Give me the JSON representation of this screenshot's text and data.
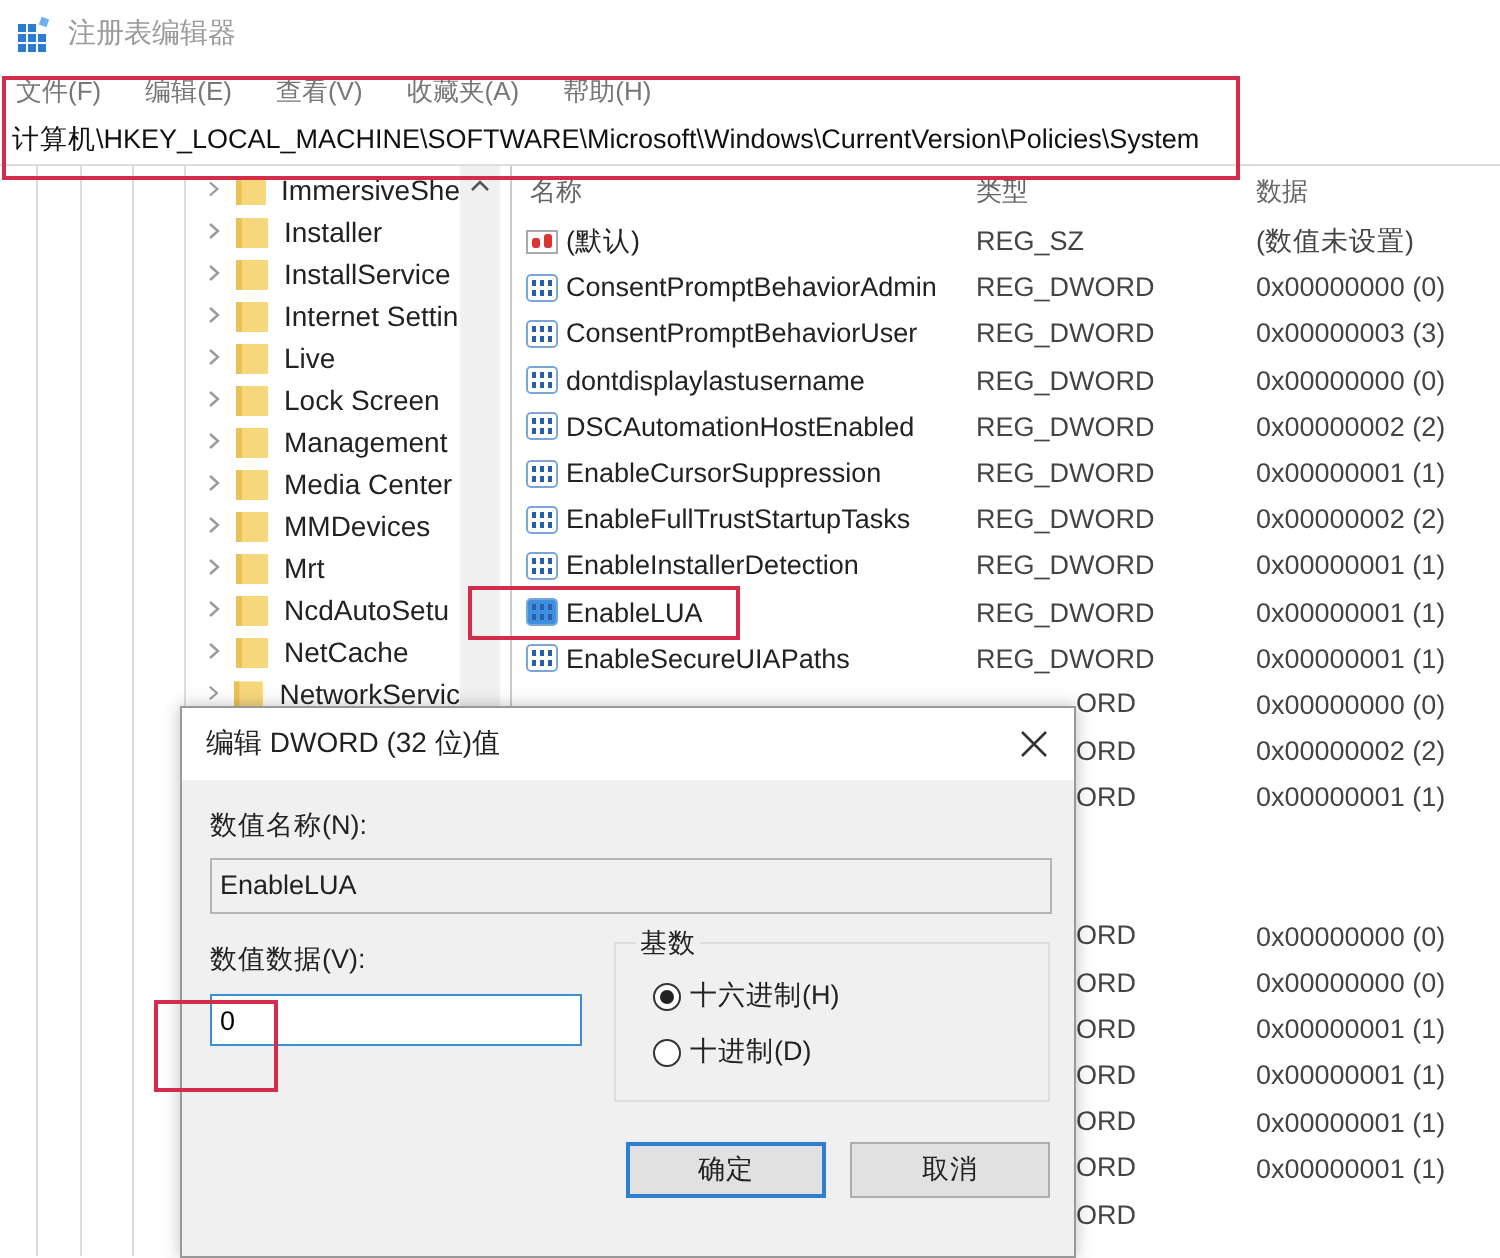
{
  "window": {
    "title": "注册表编辑器"
  },
  "menu": [
    "文件(F)",
    "编辑(E)",
    "查看(V)",
    "收藏夹(A)",
    "帮助(H)"
  ],
  "address_bar": {
    "path": "计算机\\HKEY_LOCAL_MACHINE\\SOFTWARE\\Microsoft\\Windows\\CurrentVersion\\Policies\\System",
    "highlighted": true
  },
  "tree": {
    "items": [
      "ImmersiveShe",
      "Installer",
      "InstallService",
      "Internet Settin",
      "Live",
      "Lock Screen",
      "Management",
      "Media Center",
      "MMDevices",
      "Mrt",
      "NcdAutoSetu",
      "NetCache",
      "NetworkServic"
    ]
  },
  "values": {
    "columns": [
      "名称",
      "类型",
      "数据"
    ],
    "rows": [
      {
        "kind": "sz",
        "name": "(默认)",
        "type": "REG_SZ",
        "data": "(数值未设置)",
        "selected": false,
        "highlighted": false
      },
      {
        "kind": "dword",
        "name": "ConsentPromptBehaviorAdmin",
        "type": "REG_DWORD",
        "data": "0x00000000 (0)",
        "selected": false,
        "highlighted": false
      },
      {
        "kind": "dword",
        "name": "ConsentPromptBehaviorUser",
        "type": "REG_DWORD",
        "data": "0x00000003 (3)",
        "selected": false,
        "highlighted": false
      },
      {
        "kind": "dword",
        "name": "dontdisplaylastusername",
        "type": "REG_DWORD",
        "data": "0x00000000 (0)",
        "selected": false,
        "highlighted": false
      },
      {
        "kind": "dword",
        "name": "DSCAutomationHostEnabled",
        "type": "REG_DWORD",
        "data": "0x00000002 (2)",
        "selected": false,
        "highlighted": false
      },
      {
        "kind": "dword",
        "name": "EnableCursorSuppression",
        "type": "REG_DWORD",
        "data": "0x00000001 (1)",
        "selected": false,
        "highlighted": false
      },
      {
        "kind": "dword",
        "name": "EnableFullTrustStartupTasks",
        "type": "REG_DWORD",
        "data": "0x00000002 (2)",
        "selected": false,
        "highlighted": false
      },
      {
        "kind": "dword",
        "name": "EnableInstallerDetection",
        "type": "REG_DWORD",
        "data": "0x00000001 (1)",
        "selected": false,
        "highlighted": false
      },
      {
        "kind": "dword",
        "name": "EnableLUA",
        "type": "REG_DWORD",
        "data": "0x00000001 (1)",
        "selected": true,
        "highlighted": true
      },
      {
        "kind": "dword",
        "name": "EnableSecureUIAPaths",
        "type": "REG_DWORD",
        "data": "0x00000001 (1)",
        "selected": false,
        "highlighted": false
      }
    ],
    "rows_under_dialog": [
      {
        "kind": "partial",
        "type": "ORD",
        "data": "0x00000000 (0)"
      },
      {
        "kind": "partial",
        "type": "ORD",
        "data": "0x00000002 (2)"
      },
      {
        "kind": "partial",
        "type": "ORD",
        "data": "0x00000001 (1)"
      },
      {
        "kind": "blank"
      },
      {
        "kind": "blank"
      },
      {
        "kind": "partial",
        "type": "ORD",
        "data": "0x00000000 (0)"
      },
      {
        "kind": "partial",
        "type": "ORD",
        "data": "0x00000000 (0)"
      },
      {
        "kind": "partial",
        "type": "ORD",
        "data": "0x00000001 (1)"
      },
      {
        "kind": "partial",
        "type": "ORD",
        "data": "0x00000001 (1)"
      },
      {
        "kind": "partial",
        "type": "ORD",
        "data": "0x00000001 (1)"
      },
      {
        "kind": "partial",
        "type": "ORD",
        "data": "0x00000001 (1)"
      },
      {
        "kind": "partial",
        "type": "ORD"
      }
    ]
  },
  "dialog": {
    "title": "编辑 DWORD (32 位)值",
    "name_label": "数值名称(N):",
    "name_value": "EnableLUA",
    "data_label": "数值数据(V):",
    "data_value": "0",
    "data_highlighted": true,
    "base": {
      "label": "基数",
      "options": [
        {
          "label": "十六进制(H)",
          "selected": true
        },
        {
          "label": "十进制(D)",
          "selected": false
        }
      ]
    },
    "buttons": [
      {
        "label": "确定",
        "default": true
      },
      {
        "label": "取消",
        "default": false
      }
    ]
  }
}
